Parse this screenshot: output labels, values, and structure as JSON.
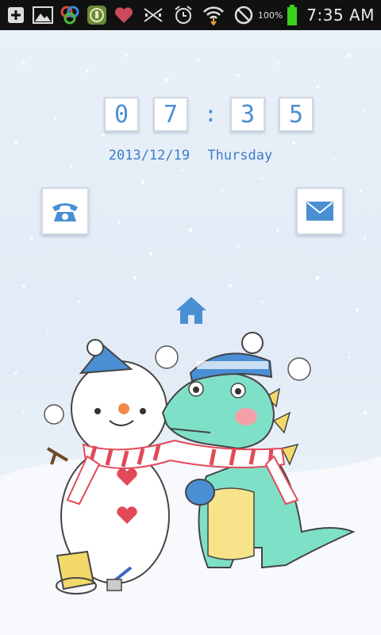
{
  "status_bar": {
    "icons": [
      "plus-icon",
      "image-icon",
      "app-icon",
      "lock-app-icon",
      "heart-icon",
      "no-signal-icon",
      "alarm-icon",
      "wifi-icon",
      "block-icon",
      "battery-icon"
    ],
    "battery_percent": "100%",
    "time": "7:35 AM"
  },
  "clock": {
    "digits": [
      "0",
      "7",
      "3",
      "5"
    ],
    "separator": ":"
  },
  "date": {
    "day": "2013/12/19",
    "weekday": "Thursday"
  },
  "colors": {
    "accent": "#4a8fd4",
    "background": "#e6eef7",
    "battery": "#3ad11c"
  }
}
